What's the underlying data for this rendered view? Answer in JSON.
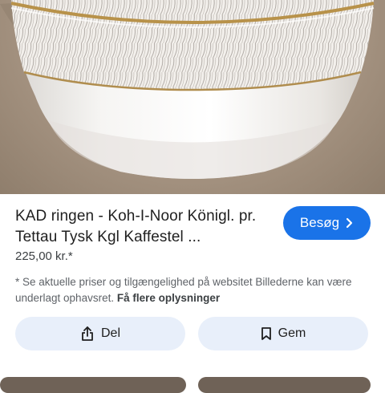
{
  "product": {
    "title": "KAD ringen - Koh-I-Noor Königl. pr. Tettau Tysk Kgl Kaffestel ...",
    "price": "225,00 kr.*",
    "disclaimer": "* Se aktuelle priser og tilgængelighed på websitet Billederne kan være underlagt ophavsret.",
    "more_info_link": "Få flere oplysninger"
  },
  "actions": {
    "visit_label": "Besøg",
    "share_label": "Del",
    "save_label": "Gem"
  },
  "colors": {
    "accent": "#1a73e8",
    "action_bg": "#e8effa"
  },
  "icons": [
    "chevron-right-icon",
    "share-icon",
    "bookmark-icon"
  ]
}
